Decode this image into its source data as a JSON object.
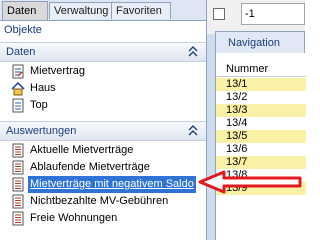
{
  "tabs": [
    "Daten",
    "Verwaltung",
    "Favoriten"
  ],
  "pane_title": "Objekte",
  "groups": {
    "daten": {
      "title": "Daten",
      "items": [
        "Mietvertrag",
        "Haus",
        "Top"
      ]
    },
    "auswertungen": {
      "title": "Auswertungen",
      "items": [
        "Aktuelle Mietverträge",
        "Ablaufende Mietverträge",
        "Mietverträge mit negativem Saldo",
        "Nichtbezahlte MV-Gebühren",
        "Freie Wohnungen"
      ]
    }
  },
  "right": {
    "field_value": "-1",
    "tab": "Navigation",
    "column": "Nummer",
    "rows": [
      "13/1",
      "13/2",
      "13/3",
      "13/4",
      "13/5",
      "13/6",
      "13/7",
      "13/8",
      "13/9"
    ]
  },
  "colors": {
    "selection": "#2f73d6",
    "arrow": "#e2191d",
    "row_highlight": "#f9f1a6"
  }
}
